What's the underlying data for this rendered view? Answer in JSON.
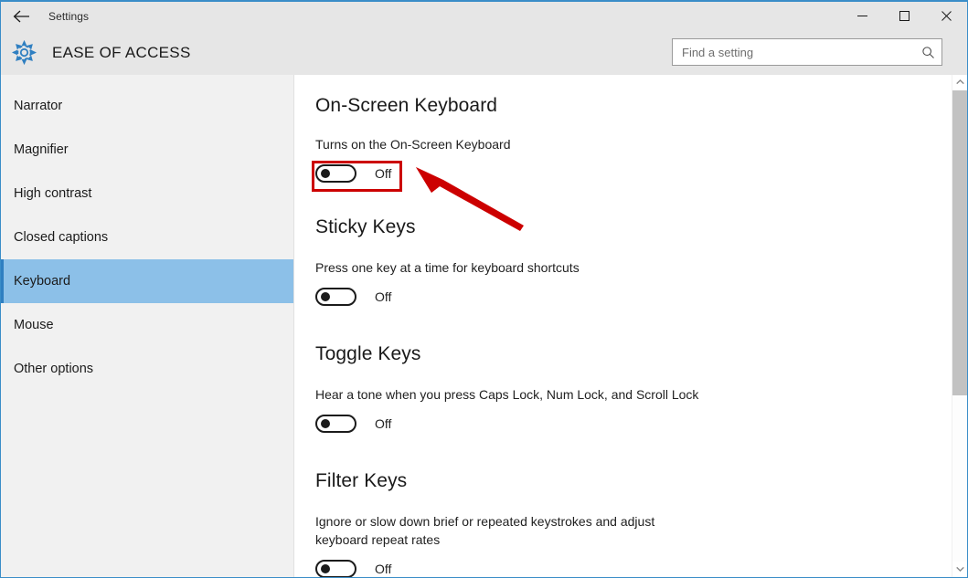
{
  "window": {
    "titlebar": {
      "back_icon": "back-arrow-icon",
      "app_title": "Settings",
      "minimize_label": "─",
      "maximize_label": "□",
      "close_label": "✕"
    },
    "header": {
      "gear_icon": "gear-icon",
      "page_title": "EASE OF ACCESS",
      "search_placeholder": "Find a setting",
      "search_value": "",
      "search_icon": "search-icon"
    },
    "accent_color": "#3a8dc8",
    "selected_item_color": "#8cc0e8"
  },
  "sidebar": {
    "items": [
      {
        "label": "Narrator",
        "selected": false
      },
      {
        "label": "Magnifier",
        "selected": false
      },
      {
        "label": "High contrast",
        "selected": false
      },
      {
        "label": "Closed captions",
        "selected": false
      },
      {
        "label": "Keyboard",
        "selected": true
      },
      {
        "label": "Mouse",
        "selected": false
      },
      {
        "label": "Other options",
        "selected": false
      }
    ]
  },
  "content": {
    "sections": [
      {
        "title": "On-Screen Keyboard",
        "description": "Turns on the On-Screen Keyboard",
        "toggle_state": "Off"
      },
      {
        "title": "Sticky Keys",
        "description": "Press one key at a time for keyboard shortcuts",
        "toggle_state": "Off"
      },
      {
        "title": "Toggle Keys",
        "description": "Hear a tone when you press Caps Lock, Num Lock, and Scroll Lock",
        "toggle_state": "Off"
      },
      {
        "title": "Filter Keys",
        "description": "Ignore or slow down brief or repeated keystrokes and adjust keyboard repeat rates",
        "toggle_state": "Off"
      }
    ]
  },
  "scrollbar": {
    "up_arrow_icon": "chevron-up-icon",
    "down_arrow_icon": "chevron-down-icon",
    "thumb_present": true
  },
  "annotations": {
    "highlight_color": "#cc0000",
    "highlight_target": "on-screen-keyboard-toggle",
    "arrow_color": "#cc0000"
  }
}
